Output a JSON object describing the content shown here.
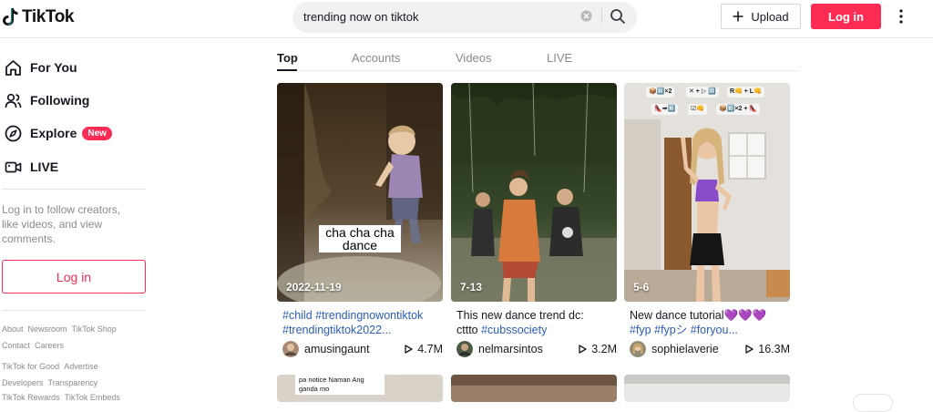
{
  "app": {
    "logo_text": "TikTok"
  },
  "header": {
    "search_value": "trending now on tiktok",
    "upload_label": "Upload",
    "login_label": "Log in"
  },
  "sidebar": {
    "nav": [
      {
        "label": "For You",
        "icon": "home-icon"
      },
      {
        "label": "Following",
        "icon": "users-icon"
      },
      {
        "label": "Explore",
        "icon": "compass-icon",
        "badge": "New"
      },
      {
        "label": "LIVE",
        "icon": "live-icon"
      }
    ],
    "note": "Log in to follow creators, like videos, and view comments.",
    "login_label": "Log in",
    "footer": [
      [
        "About",
        "Newsroom",
        "TikTok Shop"
      ],
      [
        "Contact",
        "Careers"
      ],
      [
        "TikTok for Good",
        "Advertise"
      ],
      [
        "Developers",
        "Transparency"
      ],
      [
        "TikTok Rewards",
        "TikTok Embeds"
      ]
    ]
  },
  "tabs": [
    "Top",
    "Accounts",
    "Videos",
    "LIVE"
  ],
  "videos": [
    {
      "date": "2022-11-19",
      "overlay": "cha cha cha dance",
      "desc_line1": [
        "#child",
        "#trendingnowontiktok"
      ],
      "desc_line2": [
        "#trendingtiktok2022..."
      ],
      "author": "amusingaunt",
      "views": "4.7M"
    },
    {
      "date": "7-13",
      "desc_line1_text": "This new dance trend",
      "desc_line1_tail": "​ dc:",
      "desc_line2_text": "cttto ",
      "desc_line2_tag": "#cubssociety",
      "author": "nelmarsintos",
      "views": "3.2M"
    },
    {
      "date": "5-6",
      "desc_line1_text": "New dance tutorial",
      "desc_line1_emoji": "💜💜💜",
      "desc_line2_tags": [
        "#fyp",
        "#fypシ",
        "#foryou..."
      ],
      "author": "sophielaverie",
      "views": "16.3M"
    }
  ],
  "bottom_preview": {
    "text": "pa notice Naman Ang ganda mo"
  },
  "colors": {
    "accent": "#fe2c55",
    "hashtag": "#2b5db9"
  }
}
